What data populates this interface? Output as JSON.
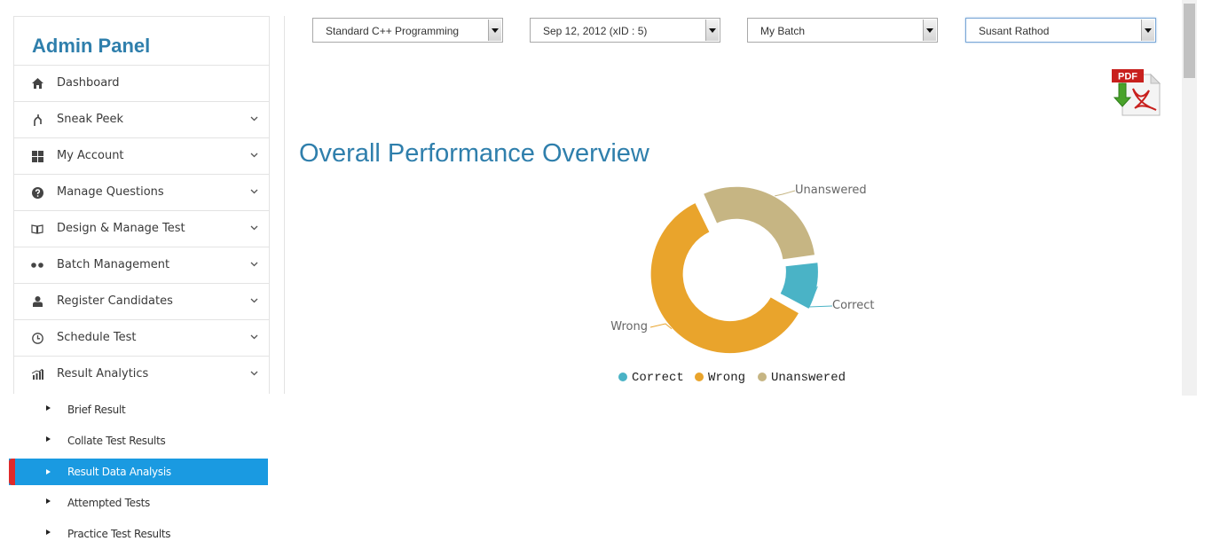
{
  "sidebar": {
    "brand": "Admin Panel",
    "items": [
      {
        "label": "Dashboard",
        "icon": "home-icon",
        "has_chevron": false
      },
      {
        "label": "Sneak Peek",
        "icon": "branch-icon",
        "has_chevron": true
      },
      {
        "label": "My Account",
        "icon": "grid-icon",
        "has_chevron": true
      },
      {
        "label": "Manage Questions",
        "icon": "question-icon",
        "has_chevron": true
      },
      {
        "label": "Design & Manage Test",
        "icon": "book-icon",
        "has_chevron": true
      },
      {
        "label": "Batch Management",
        "icon": "group-dots-icon",
        "has_chevron": true
      },
      {
        "label": "Register Candidates",
        "icon": "user-icon",
        "has_chevron": true
      },
      {
        "label": "Schedule Test",
        "icon": "clock-icon",
        "has_chevron": true
      },
      {
        "label": "Result Analytics",
        "icon": "bar-chart-icon",
        "has_chevron": true
      }
    ],
    "submenu": [
      {
        "label": "Brief Result",
        "active": false
      },
      {
        "label": "Collate Test Results",
        "active": false
      },
      {
        "label": "Result Data Analysis",
        "active": true
      },
      {
        "label": "Attempted Tests",
        "active": false
      },
      {
        "label": "Practice Test Results",
        "active": false
      }
    ],
    "active_color": "#1a9ae1",
    "active_marker_color": "#e02a2a"
  },
  "filters": {
    "course": "Standard C++ Programming",
    "test_date": "Sep 12, 2012 (xID : 5)",
    "batch": "My Batch",
    "candidate": "Susant Rathod"
  },
  "pdf_button": {
    "icon": "pdf-download-icon",
    "label": "PDF"
  },
  "main": {
    "title": "Overall Performance Overview"
  },
  "chart_data": {
    "type": "pie",
    "variant": "donut",
    "title": "",
    "categories": [
      "Correct",
      "Wrong",
      "Unanswered"
    ],
    "values": [
      10,
      60,
      30
    ],
    "colors": [
      "#4ab3c6",
      "#e9a42c",
      "#c6b583"
    ],
    "legend": {
      "placement": "bottom",
      "entries": [
        "Correct",
        "Wrong",
        "Unanswered"
      ]
    }
  },
  "colors": {
    "brand": "#2f7fac"
  }
}
